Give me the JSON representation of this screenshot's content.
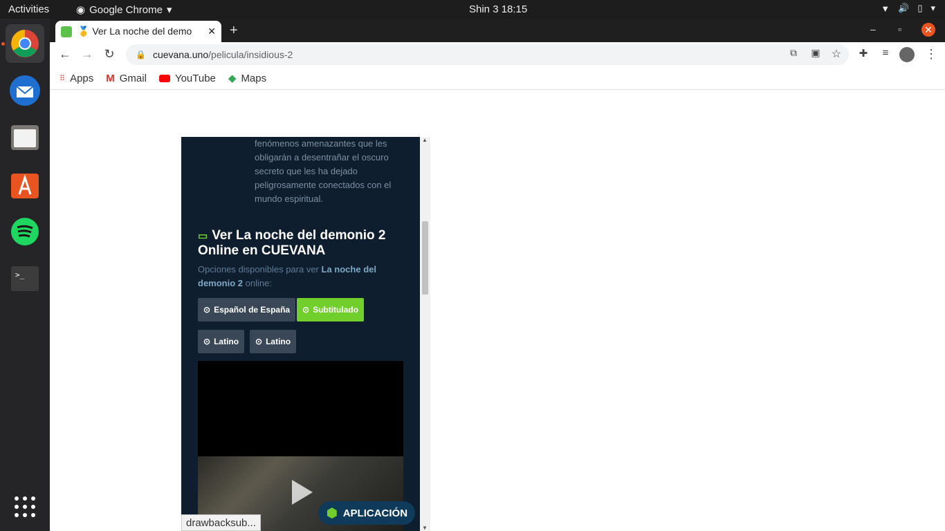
{
  "topbar": {
    "activities": "Activities",
    "app_name": "Google Chrome",
    "clock": "Shin 3  18:15"
  },
  "dock": {
    "items": [
      "chrome-icon",
      "thunderbird-icon",
      "files-icon",
      "software-icon",
      "spotify-icon",
      "terminal-icon",
      "app-grid-icon"
    ]
  },
  "browser": {
    "tab_title": "🥇 Ver La noche del demo",
    "url_host": "cuevana.uno",
    "url_path": "/pelicula/insidious-2",
    "bookmarks": [
      "Apps",
      "Gmail",
      "YouTube",
      "Maps"
    ]
  },
  "page": {
    "synopsis": "fenómenos amenazantes que les obligarán a desentrañar el oscuro secreto que les ha dejado peligrosamente conectados con el mundo espiritual.",
    "heading": "Ver La noche del demonio 2 Online en CUEVANA",
    "options_prefix": "Opciones disponibles para ver",
    "options_title": "La noche del demonio 2",
    "options_suffix": "online:",
    "buttons": [
      "Español de España",
      "Subtitulado",
      "Latino",
      "Latino"
    ],
    "app_button": "APLICACIÓN",
    "status_url": "drawbacksub..."
  },
  "colors": {
    "accent_green": "#70cf2b",
    "panel_bg": "#0f1e2e"
  }
}
